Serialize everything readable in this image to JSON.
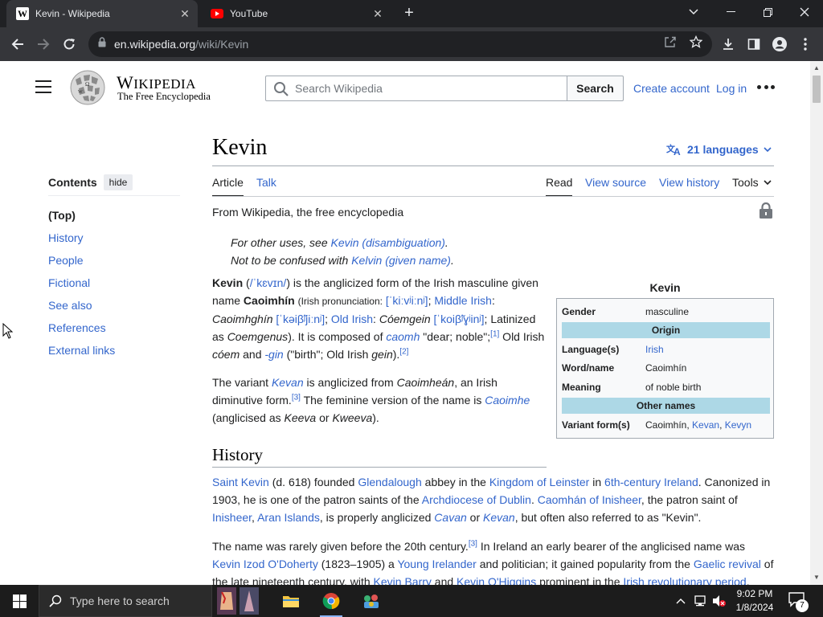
{
  "browser": {
    "tabs": [
      {
        "title": "Kevin - Wikipedia",
        "favicon": "wikipedia-w-icon",
        "active": true
      },
      {
        "title": "YouTube",
        "favicon": "youtube-icon",
        "active": false
      }
    ],
    "url_host": "en.wikipedia.org",
    "url_path": "/wiki/Kevin"
  },
  "header": {
    "wordmark_big": "W",
    "wordmark_rest": "IKIPEDIA",
    "tagline": "The Free Encyclopedia",
    "search_placeholder": "Search Wikipedia",
    "search_button": "Search",
    "create_account": "Create account",
    "login": "Log in"
  },
  "toc": {
    "title": "Contents",
    "hide": "hide",
    "items": [
      "(Top)",
      "History",
      "People",
      "Fictional",
      "See also",
      "References",
      "External links"
    ]
  },
  "article": {
    "title": "Kevin",
    "languages": "21 languages",
    "tabs_left": [
      "Article",
      "Talk"
    ],
    "tabs_right": [
      "Read",
      "View source",
      "View history",
      "Tools"
    ],
    "from": "From Wikipedia, the free encyclopedia",
    "hatnote1_pre": "For other uses, see ",
    "hatnote1_link": "Kevin (disambiguation)",
    "hatnote1_post": ".",
    "hatnote2_pre": "Not to be confused with ",
    "hatnote2_link": "Kelvin (given name)",
    "hatnote2_post": ".",
    "history_heading": "History"
  },
  "infobox": {
    "caption": "Kevin",
    "gender_label": "Gender",
    "gender_value": "masculine",
    "origin_head": "Origin",
    "language_label": "Language(s)",
    "language_value": "Irish",
    "wordname_label": "Word/name",
    "wordname_value": "Caoimhín",
    "meaning_label": "Meaning",
    "meaning_value": "of noble birth",
    "othernames_head": "Other names",
    "variant_label": "Variant form(s)",
    "variant_value_plain": "Caoimhín, ",
    "variant_link1": "Kevan",
    "variant_sep": ", ",
    "variant_link2": "Kevyn"
  },
  "taskbar": {
    "search_placeholder": "Type here to search",
    "time": "9:02 PM",
    "date": "1/8/2024",
    "notifications": "7"
  },
  "colors": {
    "link": "#3366cc",
    "infobox_header": "#add8e6",
    "chrome_dark": "#202124",
    "chrome_toolbar": "#35363a"
  }
}
